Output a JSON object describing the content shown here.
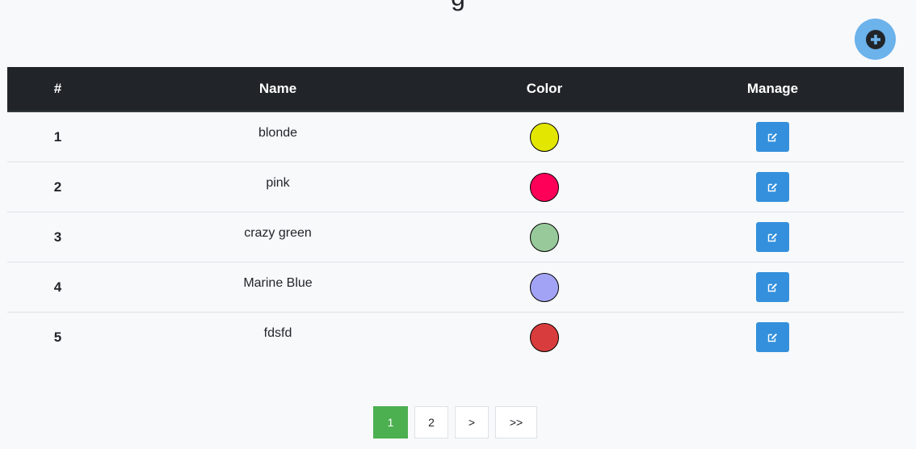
{
  "header": {
    "title_fragment": "g"
  },
  "table": {
    "columns": [
      "#",
      "Name",
      "Color",
      "Manage"
    ],
    "rows": [
      {
        "num": "1",
        "name": "blonde",
        "color": "#e2e600"
      },
      {
        "num": "2",
        "name": "pink",
        "color": "#ff0058"
      },
      {
        "num": "3",
        "name": "crazy green",
        "color": "#97c99a"
      },
      {
        "num": "4",
        "name": "Marine Blue",
        "color": "#a3a3f5"
      },
      {
        "num": "5",
        "name": "fdsfd",
        "color": "#d83c3c"
      }
    ]
  },
  "actions": {
    "add_icon": "plus-circle-icon",
    "edit_icon": "edit-icon",
    "accent": "#3490dc",
    "add_bg": "#6cb2eb"
  },
  "pagination": {
    "pages": [
      "1",
      "2"
    ],
    "next": ">",
    "last": ">>",
    "active": "1",
    "active_color": "#4caf50"
  }
}
